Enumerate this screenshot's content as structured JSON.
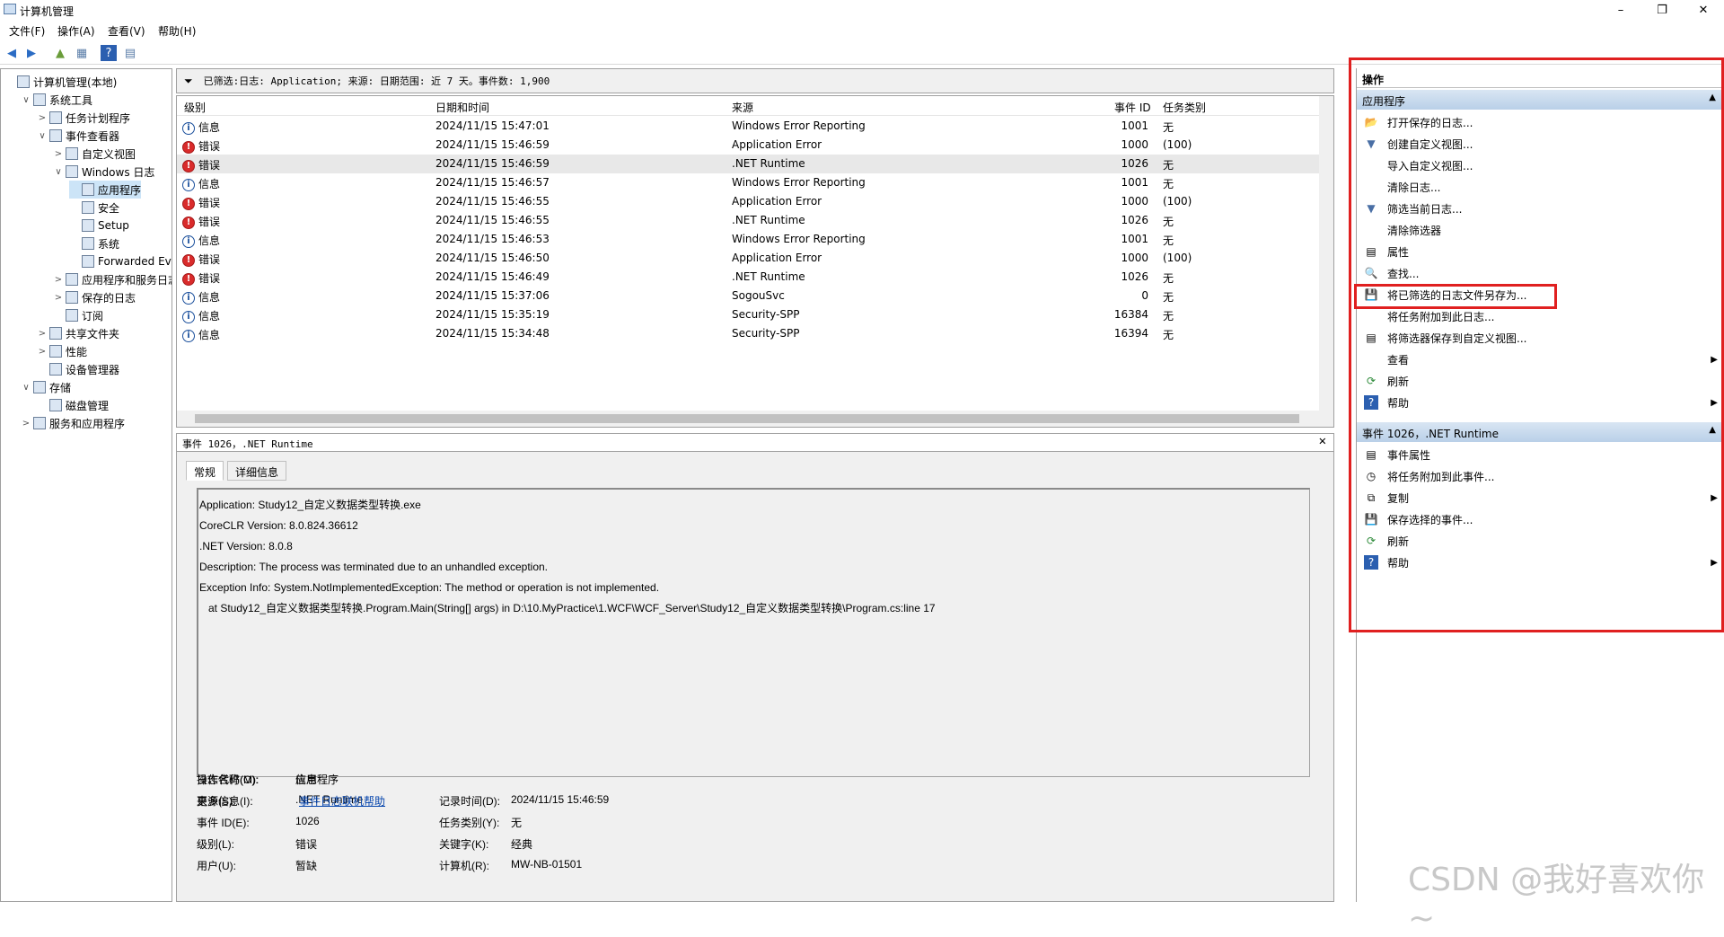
{
  "window": {
    "title": "计算机管理",
    "min_icon": "–",
    "max_icon": "❐",
    "close_icon": "✕"
  },
  "menu": [
    "文件(F)",
    "操作(A)",
    "查看(V)",
    "帮助(H)"
  ],
  "toolbar_icons": [
    "back-arrow",
    "forward-arrow",
    "up-folder",
    "show-hide-tree",
    "help",
    "properties"
  ],
  "tree": [
    {
      "label": "计算机管理(本地)",
      "depth": 0,
      "expander": "",
      "icon": "computer"
    },
    {
      "label": "系统工具",
      "depth": 1,
      "expander": "∨",
      "icon": "tools"
    },
    {
      "label": "任务计划程序",
      "depth": 2,
      "expander": ">",
      "icon": "clock"
    },
    {
      "label": "事件查看器",
      "depth": 2,
      "expander": "∨",
      "icon": "event"
    },
    {
      "label": "自定义视图",
      "depth": 3,
      "expander": ">",
      "icon": "folder"
    },
    {
      "label": "Windows 日志",
      "depth": 3,
      "expander": "∨",
      "icon": "folder"
    },
    {
      "label": "应用程序",
      "depth": 4,
      "expander": "",
      "icon": "log",
      "selected": true
    },
    {
      "label": "安全",
      "depth": 4,
      "expander": "",
      "icon": "log"
    },
    {
      "label": "Setup",
      "depth": 4,
      "expander": "",
      "icon": "log"
    },
    {
      "label": "系统",
      "depth": 4,
      "expander": "",
      "icon": "log"
    },
    {
      "label": "Forwarded Eve",
      "depth": 4,
      "expander": "",
      "icon": "log"
    },
    {
      "label": "应用程序和服务日志",
      "depth": 3,
      "expander": ">",
      "icon": "folder"
    },
    {
      "label": "保存的日志",
      "depth": 3,
      "expander": ">",
      "icon": "folder"
    },
    {
      "label": "订阅",
      "depth": 3,
      "expander": "",
      "icon": "subscribe"
    },
    {
      "label": "共享文件夹",
      "depth": 2,
      "expander": ">",
      "icon": "share"
    },
    {
      "label": "性能",
      "depth": 2,
      "expander": ">",
      "icon": "perf"
    },
    {
      "label": "设备管理器",
      "depth": 2,
      "expander": "",
      "icon": "device"
    },
    {
      "label": "存储",
      "depth": 1,
      "expander": "∨",
      "icon": "storage"
    },
    {
      "label": "磁盘管理",
      "depth": 2,
      "expander": "",
      "icon": "disk"
    },
    {
      "label": "服务和应用程序",
      "depth": 1,
      "expander": ">",
      "icon": "services"
    }
  ],
  "filter": {
    "text": "已筛选:日志: Application; 来源: 日期范围: 近 7 天。事件数: 1,900"
  },
  "events": {
    "columns": [
      "级别",
      "日期和时间",
      "来源",
      "事件 ID",
      "任务类别"
    ],
    "rows": [
      {
        "level": "信息",
        "type": "info",
        "time": "2024/11/15 15:47:01",
        "source": "Windows Error Reporting",
        "id": "1001",
        "cat": "无"
      },
      {
        "level": "错误",
        "type": "error",
        "time": "2024/11/15 15:46:59",
        "source": "Application Error",
        "id": "1000",
        "cat": "(100)"
      },
      {
        "level": "错误",
        "type": "error",
        "time": "2024/11/15 15:46:59",
        "source": ".NET Runtime",
        "id": "1026",
        "cat": "无",
        "selected": true
      },
      {
        "level": "信息",
        "type": "info",
        "time": "2024/11/15 15:46:57",
        "source": "Windows Error Reporting",
        "id": "1001",
        "cat": "无"
      },
      {
        "level": "错误",
        "type": "error",
        "time": "2024/11/15 15:46:55",
        "source": "Application Error",
        "id": "1000",
        "cat": "(100)"
      },
      {
        "level": "错误",
        "type": "error",
        "time": "2024/11/15 15:46:55",
        "source": ".NET Runtime",
        "id": "1026",
        "cat": "无"
      },
      {
        "level": "信息",
        "type": "info",
        "time": "2024/11/15 15:46:53",
        "source": "Windows Error Reporting",
        "id": "1001",
        "cat": "无"
      },
      {
        "level": "错误",
        "type": "error",
        "time": "2024/11/15 15:46:50",
        "source": "Application Error",
        "id": "1000",
        "cat": "(100)"
      },
      {
        "level": "错误",
        "type": "error",
        "time": "2024/11/15 15:46:49",
        "source": ".NET Runtime",
        "id": "1026",
        "cat": "无"
      },
      {
        "level": "信息",
        "type": "info",
        "time": "2024/11/15 15:37:06",
        "source": "SogouSvc",
        "id": "0",
        "cat": "无"
      },
      {
        "level": "信息",
        "type": "info",
        "time": "2024/11/15 15:35:19",
        "source": "Security-SPP",
        "id": "16384",
        "cat": "无"
      },
      {
        "level": "信息",
        "type": "info",
        "time": "2024/11/15 15:34:48",
        "source": "Security-SPP",
        "id": "16394",
        "cat": "无"
      }
    ]
  },
  "detail": {
    "header": "事件 1026，.NET Runtime",
    "tabs": [
      "常规",
      "详细信息"
    ],
    "description": [
      "Application: Study12_自定义数据类型转换.exe",
      "CoreCLR Version: 8.0.824.36612",
      ".NET Version: 8.0.8",
      "Description: The process was terminated due to an unhandled exception.",
      "Exception Info: System.NotImplementedException: The method or operation is not implemented.",
      "   at Study12_自定义数据类型转换.Program.Main(String[] args) in D:\\10.MyPractice\\1.WCF\\WCF_Server\\Study12_自定义数据类型转换\\Program.cs:line 17"
    ],
    "fields": {
      "log_name_label": "日志名称(M):",
      "log_name": "应用程序",
      "source_label": "来源(S):",
      "source": ".NET Runtime",
      "logged_label": "记录时间(D):",
      "logged": "2024/11/15 15:46:59",
      "event_id_label": "事件 ID(E):",
      "event_id": "1026",
      "task_label": "任务类别(Y):",
      "task": "无",
      "level_label": "级别(L):",
      "level": "错误",
      "keywords_label": "关键字(K):",
      "keywords": "经典",
      "user_label": "用户(U):",
      "user": "暂缺",
      "computer_label": "计算机(R):",
      "computer": "MW-NB-01501",
      "opcode_label": "操作代码(O):",
      "opcode": "信息",
      "more_label": "更多信息(I):",
      "more_link": "事件日志联机帮助"
    }
  },
  "actions": {
    "title": "操作",
    "section1": "应用程序",
    "items1": [
      {
        "label": "打开保存的日志...",
        "icon": "open-icon",
        "glyph": "📂"
      },
      {
        "label": "创建自定义视图...",
        "icon": "filter-create-icon",
        "glyph": "▼"
      },
      {
        "label": "导入自定义视图...",
        "icon": "",
        "glyph": ""
      },
      {
        "label": "清除日志...",
        "icon": "",
        "glyph": ""
      },
      {
        "label": "筛选当前日志...",
        "icon": "filter-icon",
        "glyph": "▼"
      },
      {
        "label": "清除筛选器",
        "icon": "",
        "glyph": ""
      },
      {
        "label": "属性",
        "icon": "properties-icon",
        "glyph": "▤"
      },
      {
        "label": "查找...",
        "icon": "binoculars-icon",
        "glyph": "🔍"
      },
      {
        "label": "将已筛选的日志文件另存为...",
        "icon": "save-icon",
        "glyph": "💾"
      },
      {
        "label": "将任务附加到此日志...",
        "icon": "",
        "glyph": ""
      },
      {
        "label": "将筛选器保存到自定义视图...",
        "icon": "save-filter-icon",
        "glyph": "▤"
      },
      {
        "label": "查看",
        "icon": "",
        "glyph": "",
        "sub": true
      },
      {
        "label": "刷新",
        "icon": "refresh-icon",
        "glyph": "⟳"
      },
      {
        "label": "帮助",
        "icon": "help-icon",
        "glyph": "?",
        "sub": true
      }
    ],
    "section2": "事件 1026，.NET Runtime",
    "items2": [
      {
        "label": "事件属性",
        "icon": "event-properties-icon",
        "glyph": "▤"
      },
      {
        "label": "将任务附加到此事件...",
        "icon": "attach-task-icon",
        "glyph": "◷"
      },
      {
        "label": "复制",
        "icon": "copy-icon",
        "glyph": "⧉",
        "sub": true
      },
      {
        "label": "保存选择的事件...",
        "icon": "save-icon",
        "glyph": "💾"
      },
      {
        "label": "刷新",
        "icon": "refresh-icon",
        "glyph": "⟳"
      },
      {
        "label": "帮助",
        "icon": "help-icon",
        "glyph": "?",
        "sub": true
      }
    ]
  },
  "watermark": "CSDN @我好喜欢你~",
  "colors": {
    "highlight": "#e02020",
    "section": "#c8dbef",
    "error": "#d92b2b",
    "info": "#1a4f9c"
  }
}
